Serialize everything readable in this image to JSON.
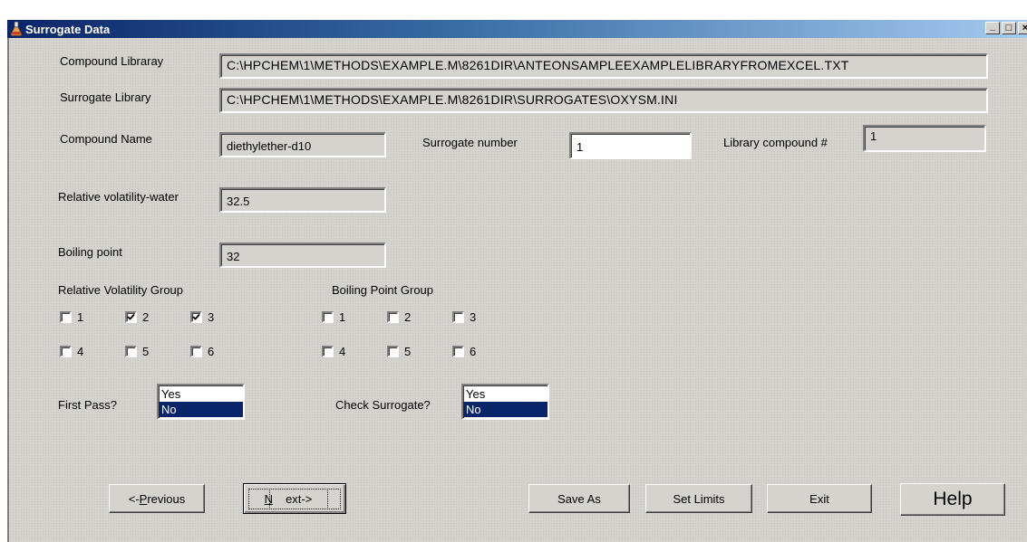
{
  "window": {
    "title": "Surrogate Data",
    "controls": [
      "_",
      "□",
      "×"
    ]
  },
  "labels": {
    "compound_library": "Compound Libraray",
    "surrogate_library": "Surrogate Library",
    "compound_name": "Compound Name",
    "surrogate_number": "Surrogate number",
    "library_compound": "Library compound #",
    "relative_volatility_water": "Relative volatility-water",
    "boiling_point": "Boiling point",
    "relative_volatility_group": "Relative Volatility Group",
    "boiling_point_group": "Boiling Point Group",
    "first_pass": "First Pass?",
    "check_surrogate": "Check Surrogate?"
  },
  "values": {
    "compound_library": "C:\\HPCHEM\\1\\METHODS\\EXAMPLE.M\\8261DIR\\ANTEONSAMPLEEXAMPLELIBRARYFROMEXCEL.TXT",
    "surrogate_library": "C:\\HPCHEM\\1\\METHODS\\EXAMPLE.M\\8261DIR\\SURROGATES\\OXYSM.INI",
    "compound_name": "diethylether-d10",
    "surrogate_number": "1",
    "library_compound": "1",
    "relative_volatility_water": "32.5",
    "boiling_point": "32"
  },
  "rv_group": [
    {
      "label": "1",
      "checked": false
    },
    {
      "label": "2",
      "checked": true
    },
    {
      "label": "3",
      "checked": true
    },
    {
      "label": "4",
      "checked": false
    },
    {
      "label": "5",
      "checked": false
    },
    {
      "label": "6",
      "checked": false
    }
  ],
  "bp_group": [
    {
      "label": "1",
      "checked": false
    },
    {
      "label": "2",
      "checked": false
    },
    {
      "label": "3",
      "checked": false
    },
    {
      "label": "4",
      "checked": false
    },
    {
      "label": "5",
      "checked": false
    },
    {
      "label": "6",
      "checked": false
    }
  ],
  "first_pass": {
    "options": [
      "Yes",
      "No"
    ],
    "selected": "No"
  },
  "check_surrogate": {
    "options": [
      "Yes",
      "No"
    ],
    "selected": "No"
  },
  "buttons": {
    "previous_prefix": "<-",
    "previous_access": "P",
    "previous_rest": "revious",
    "next_access": "N",
    "next_rest": "ext->",
    "save_as": "Save As",
    "set_limits": "Set Limits",
    "exit": "Exit",
    "help": "Help"
  },
  "colors": {
    "titlebar_start": "#0a246a",
    "titlebar_end": "#a6caf0",
    "face": "#d6d3ce",
    "selection": "#0a246a"
  }
}
